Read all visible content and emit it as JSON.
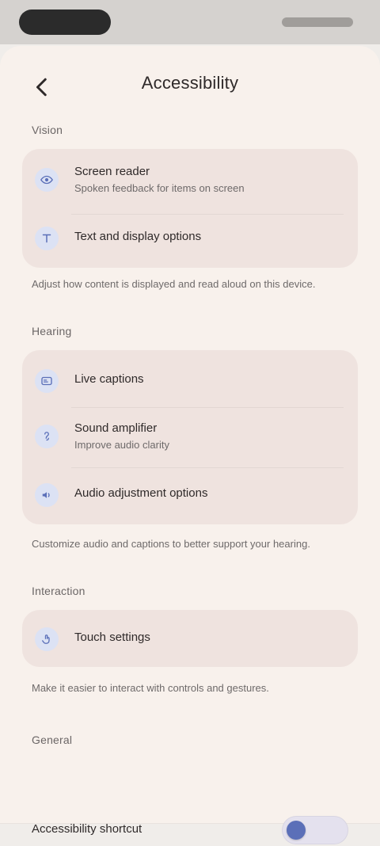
{
  "header": {
    "title": "Accessibility"
  },
  "sections": [
    {
      "label": "Vision",
      "items": [
        {
          "icon": "eye-icon",
          "primary": "Screen reader",
          "secondary": "Spoken feedback for items on screen"
        },
        {
          "icon": "text-icon",
          "primary": "Text and display options",
          "secondary": ""
        }
      ],
      "footnote": "Adjust how content is displayed and read aloud on this device."
    },
    {
      "label": "Hearing",
      "items": [
        {
          "icon": "captions-icon",
          "primary": "Live captions",
          "secondary": ""
        },
        {
          "icon": "hearing-icon",
          "primary": "Sound amplifier",
          "secondary": "Improve audio clarity"
        },
        {
          "icon": "volume-icon",
          "primary": "Audio adjustment options",
          "secondary": ""
        }
      ],
      "footnote": "Customize audio and captions to better support your hearing."
    },
    {
      "label": "Interaction",
      "items": [
        {
          "icon": "touch-icon",
          "primary": "Touch settings",
          "secondary": ""
        }
      ],
      "footnote": "Make it easier to interact with controls and gestures."
    }
  ],
  "bottom": {
    "section_label": "General",
    "toggle_label": "Accessibility shortcut"
  },
  "colors": {
    "background": "#F8F1EC",
    "card": "#EFE3DF",
    "accent": "#5B6FB8"
  }
}
